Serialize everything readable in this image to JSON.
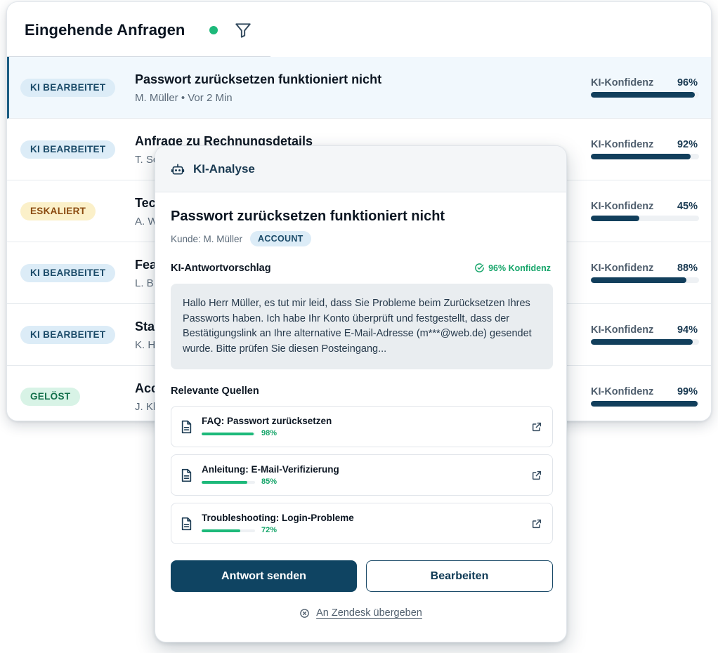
{
  "inbox": {
    "title": "Eingehende Anfragen",
    "live_color": "#1db97a",
    "conf_label": "KI-Konfidenz",
    "rows": [
      {
        "status": "KI BEARBEITET",
        "status_kind": "ki",
        "title": "Passwort zurücksetzen funktioniert nicht",
        "meta": "M. Müller • Vor 2 Min",
        "confidence_label": "96%",
        "confidence": 0.96,
        "active": true
      },
      {
        "status": "KI BEARBEITET",
        "status_kind": "ki",
        "title": "Anfrage zu Rechnungsdetails",
        "meta": "T. Sc",
        "confidence_label": "92%",
        "confidence": 0.92,
        "active": false
      },
      {
        "status": "ESKALIERT",
        "status_kind": "esk",
        "title": "Tec",
        "meta": "A. W",
        "confidence_label": "45%",
        "confidence": 0.45,
        "active": false
      },
      {
        "status": "KI BEARBEITET",
        "status_kind": "ki",
        "title": "Fea",
        "meta": "L. B",
        "confidence_label": "88%",
        "confidence": 0.88,
        "active": false
      },
      {
        "status": "KI BEARBEITET",
        "status_kind": "ki",
        "title": "Sta",
        "meta": "K. H",
        "confidence_label": "94%",
        "confidence": 0.94,
        "active": false
      },
      {
        "status": "GELÖST",
        "status_kind": "gel",
        "title": "Acc",
        "meta": "J. Kl",
        "confidence_label": "99%",
        "confidence": 0.99,
        "active": false
      }
    ]
  },
  "analysis": {
    "header_title": "KI-Analyse",
    "title": "Passwort zurücksetzen funktioniert nicht",
    "customer": "Kunde: M. Müller",
    "tag": "ACCOUNT",
    "suggestion_label": "KI-Antwortvorschlag",
    "confidence_pill": "96% Konfidenz",
    "suggestion_text": "Hallo Herr Müller, es tut mir leid, dass Sie Probleme beim Zurücksetzen Ihres Passworts haben. Ich habe Ihr Konto überprüft und festgestellt, dass der Bestätigungslink an Ihre alternative E-Mail-Adresse (m***@web.de) gesendet wurde. Bitte prüfen Sie diesen Posteingang...",
    "sources_label": "Relevante Quellen",
    "sources": [
      {
        "title": "FAQ: Passwort zurücksetzen",
        "relevance_label": "98%",
        "relevance": 0.98
      },
      {
        "title": "Anleitung: E-Mail-Verifizierung",
        "relevance_label": "85%",
        "relevance": 0.85
      },
      {
        "title": "Troubleshooting: Login-Probleme",
        "relevance_label": "72%",
        "relevance": 0.72
      }
    ],
    "send_label": "Antwort senden",
    "edit_label": "Bearbeiten",
    "handover_label": "An Zendesk übergeben"
  },
  "icons": [
    "filter-icon",
    "robot-icon",
    "check-circle-icon",
    "document-icon",
    "external-link-icon",
    "x-circle-icon"
  ],
  "colors": {
    "primary": "#0f4462",
    "success": "#1db97a",
    "badge_ki_bg": "#dcecf7",
    "badge_esk_bg": "#fbf0c9",
    "badge_gel_bg": "#d8f3e6"
  }
}
